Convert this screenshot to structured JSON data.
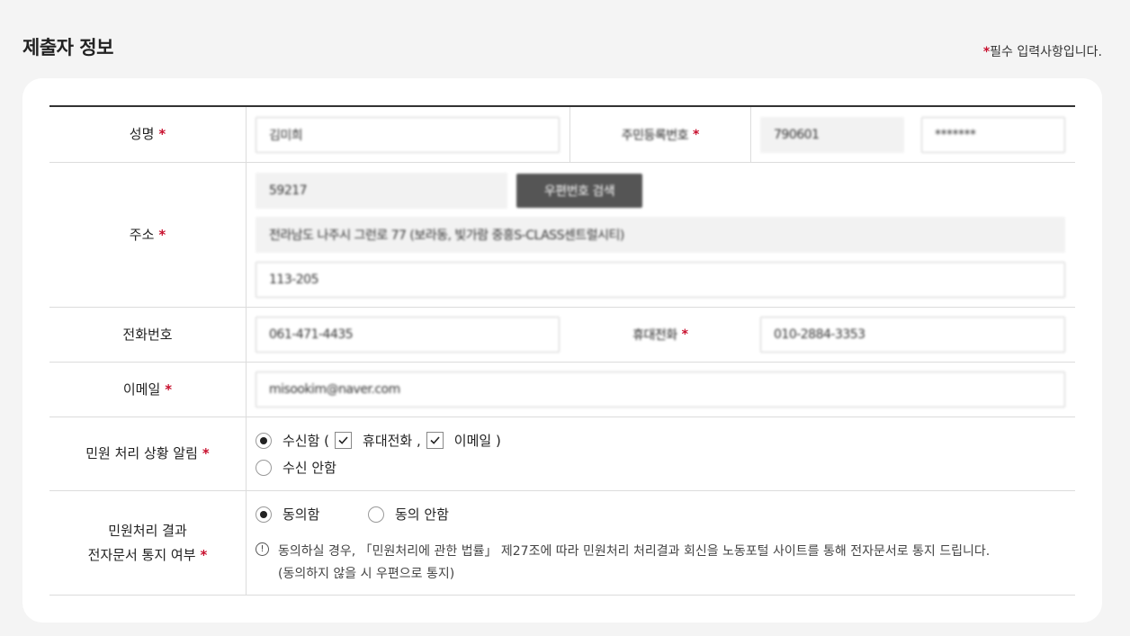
{
  "header": {
    "title": "제출자 정보",
    "required_star": "*",
    "required_note": "필수 입력사항입니다."
  },
  "form": {
    "name": {
      "label": "성명",
      "value": "김미희",
      "id_label": "주민등록번호",
      "id_front": "790601",
      "id_back": "*******"
    },
    "address": {
      "label": "주소",
      "zipcode": "59217",
      "search_button": "우편번호 검색",
      "address_main": "전라남도 나주시 그런로 77 (보라동, 빛가람 중흥S-CLASS센트럴시티)",
      "address_detail": "113-205"
    },
    "phone": {
      "label": "전화번호",
      "value": "061-471-4435",
      "mobile_label": "휴대전화",
      "mobile_value": "010-2884-3353"
    },
    "email": {
      "label": "이메일",
      "value": "misookim@naver.com"
    },
    "notify": {
      "label": "민원 처리 상황 알림",
      "opt_receive": "수신함 (",
      "opt_mobile": "휴대전화 ,",
      "opt_email": "이메일 )",
      "opt_no_receive": "수신 안함"
    },
    "edoc": {
      "label_line1": "민원처리 결과",
      "label_line2": "전자문서 통지 여부",
      "opt_agree": "동의함",
      "opt_disagree": "동의 안함",
      "notice_icon": "!",
      "notice_line1": "동의하실 경우, 「민원처리에 관한 법률」 제27조에 따라 민원처리 처리결과 회신을 노동포털 사이트를 통해 전자문서로 통지 드립니다.",
      "notice_line2": "(동의하지 않을 시 우편으로 통지)"
    }
  },
  "colors": {
    "accent_star": "#c8102e",
    "button_bg": "#555555",
    "page_bg": "#f4f4f4"
  }
}
